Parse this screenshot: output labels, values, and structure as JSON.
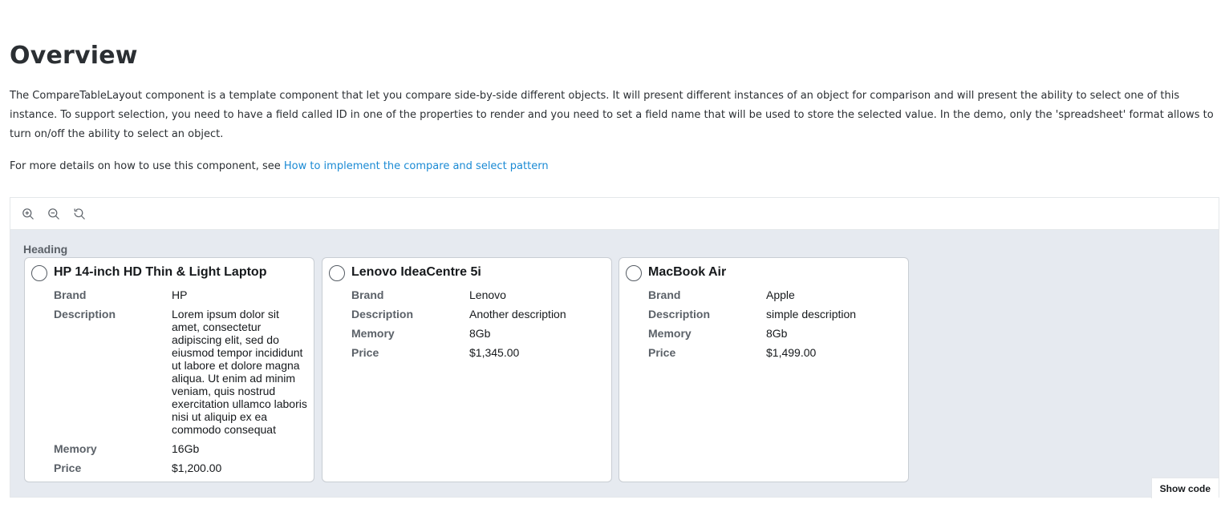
{
  "page": {
    "title": "Overview",
    "description": "The CompareTableLayout component is a template component that let you compare side-by-side different objects. It will present different instances of an object for comparison and will present the ability to select one of this instance. To support selection, you need to have a field called ID in one of the properties to render and you need to set a field name that will be used to store the selected value. In the demo, only the 'spreadsheet' format allows to turn on/off the ability to select an object.",
    "more_prefix": "For more details on how to use this component, see ",
    "more_link": "How to implement the compare and select pattern"
  },
  "toolbar": {
    "icons": [
      "zoom-in-icon",
      "zoom-out-icon",
      "reset-zoom-icon"
    ]
  },
  "demo": {
    "heading": "Heading",
    "show_code": "Show code",
    "cards": [
      {
        "title": "HP 14-inch HD Thin & Light Laptop",
        "props": [
          {
            "label": "Brand",
            "value": "HP"
          },
          {
            "label": "Description",
            "value": "Lorem ipsum dolor sit amet, consectetur adipiscing elit, sed do eiusmod tempor incididunt ut labore et dolore magna aliqua. Ut enim ad minim veniam, quis nostrud exercitation ullamco laboris nisi ut aliquip ex ea commodo consequat"
          },
          {
            "label": "Memory",
            "value": "16Gb"
          },
          {
            "label": "Price",
            "value": "$1,200.00"
          }
        ]
      },
      {
        "title": "Lenovo IdeaCentre 5i",
        "props": [
          {
            "label": "Brand",
            "value": "Lenovo"
          },
          {
            "label": "Description",
            "value": "Another description"
          },
          {
            "label": "Memory",
            "value": "8Gb"
          },
          {
            "label": "Price",
            "value": "$1,345.00"
          }
        ]
      },
      {
        "title": "MacBook Air",
        "props": [
          {
            "label": "Brand",
            "value": "Apple"
          },
          {
            "label": "Description",
            "value": "simple description"
          },
          {
            "label": "Memory",
            "value": "8Gb"
          },
          {
            "label": "Price",
            "value": "$1,499.00"
          }
        ]
      }
    ]
  }
}
